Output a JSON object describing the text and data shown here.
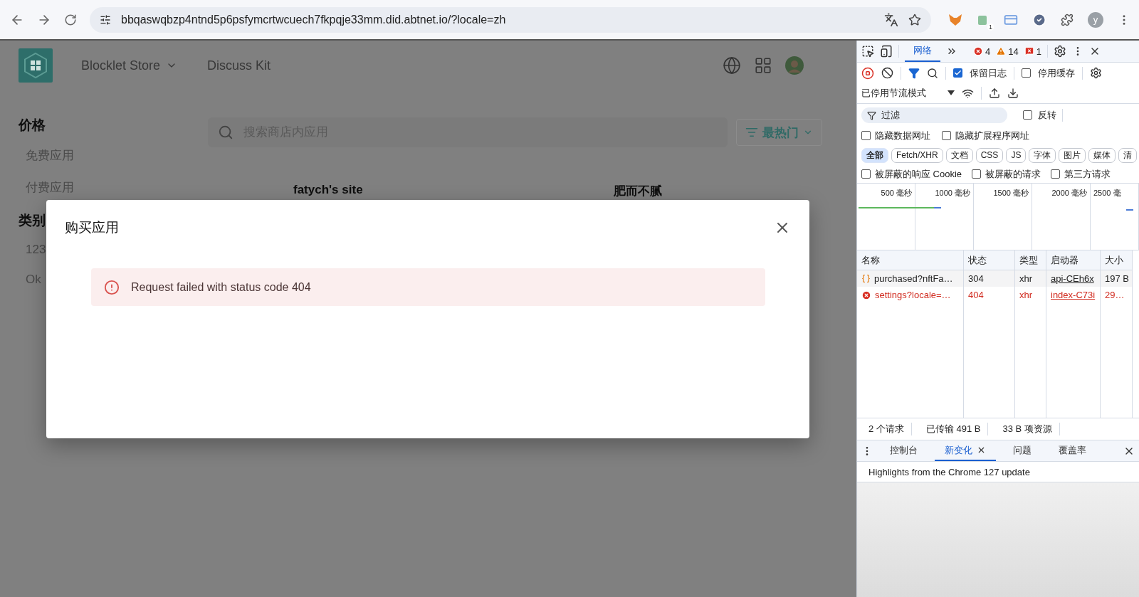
{
  "browser": {
    "url": "bbqaswqbzp4ntnd5p6psfymcrtwcuech7fkpqje33mm.did.abtnet.io/?locale=zh",
    "extension_badge": "1",
    "profile_initial": "y"
  },
  "page": {
    "nav": [
      {
        "label": "Blocklet Store",
        "has_menu": true
      },
      {
        "label": "Discuss Kit",
        "has_menu": false
      }
    ],
    "sidebar": [
      {
        "title": "价格",
        "items": [
          "免费应用",
          "付费应用"
        ]
      },
      {
        "title": "类别",
        "items": [
          "123",
          "Ok"
        ]
      }
    ],
    "search": {
      "placeholder": "搜索商店内应用"
    },
    "sort": {
      "label": "最热门"
    },
    "cards": [
      {
        "title": "fatych's site"
      },
      {
        "title": "肥而不腻"
      }
    ]
  },
  "dialog": {
    "title": "购买应用",
    "alert": {
      "error": true,
      "message": "Request failed with status code 404"
    }
  },
  "devtools": {
    "panel_tabs": [
      {
        "label": "网络",
        "selected": true
      }
    ],
    "counts": [
      {
        "kind": "error",
        "count": "4"
      },
      {
        "kind": "warning",
        "count": "14"
      },
      {
        "kind": "issue",
        "count": "1"
      }
    ],
    "recording": true,
    "options": [
      {
        "label": "保留日志",
        "checked": true
      },
      {
        "label": "停用缓存",
        "checked": false
      }
    ],
    "throttling": "已停用节流模式",
    "filter": {
      "placeholder": "过滤"
    },
    "invert": {
      "label": "反转",
      "checked": false
    },
    "hide_options": [
      {
        "label": "隐藏数据网址",
        "checked": false
      },
      {
        "label": "隐藏扩展程序网址",
        "checked": false
      }
    ],
    "type_filters": [
      {
        "label": "全部",
        "selected": true
      },
      {
        "label": "Fetch/XHR",
        "selected": false
      },
      {
        "label": "文档",
        "selected": false
      },
      {
        "label": "CSS",
        "selected": false
      },
      {
        "label": "JS",
        "selected": false
      },
      {
        "label": "字体",
        "selected": false
      },
      {
        "label": "图片",
        "selected": false
      },
      {
        "label": "媒体",
        "selected": false
      },
      {
        "label": "清",
        "selected": false
      }
    ],
    "blocked_options": [
      {
        "label": "被屏蔽的响应 Cookie",
        "checked": false
      },
      {
        "label": "被屏蔽的请求",
        "checked": false
      },
      {
        "label": "第三方请求",
        "checked": false
      }
    ],
    "timeline_ticks": [
      "500 毫秒",
      "1000 毫秒",
      "1500 毫秒",
      "2000 毫秒",
      "2500 毫"
    ],
    "columns": [
      "名称",
      "状态",
      "类型",
      "启动器",
      "大小"
    ],
    "rows": [
      {
        "failed": false,
        "name": "purchased?nftFa…",
        "status": "304",
        "type": "xhr",
        "initiator": "api-CEh6x",
        "size": "197 B"
      },
      {
        "failed": true,
        "name": "settings?locale=…",
        "status": "404",
        "type": "xhr",
        "initiator": "index-C73i",
        "size": "29…"
      }
    ],
    "summary": [
      "2 个请求",
      "已传输 491 B",
      "33 B 项资源"
    ],
    "drawer_tabs": [
      {
        "label": "控制台",
        "selected": false,
        "closable": false
      },
      {
        "label": "新变化",
        "selected": true,
        "closable": true
      },
      {
        "label": "问题",
        "selected": false,
        "closable": false
      },
      {
        "label": "覆盖率",
        "selected": false,
        "closable": false
      }
    ],
    "drawer_text": "Highlights from the Chrome 127 update"
  }
}
